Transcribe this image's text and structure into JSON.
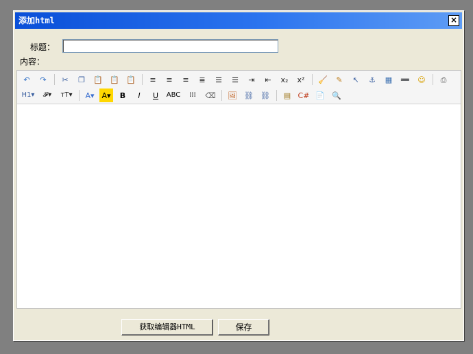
{
  "dialog": {
    "title": "添加html",
    "close_label": "×"
  },
  "form": {
    "title_label": "标题：",
    "content_label": "内容：",
    "title_value": ""
  },
  "toolbar": {
    "row1": [
      {
        "name": "undo-icon",
        "glyph": "↶",
        "color": "#2b6cc4"
      },
      {
        "name": "redo-icon",
        "glyph": "↷",
        "color": "#2b6cc4"
      },
      {
        "sep": true
      },
      {
        "name": "cut-icon",
        "glyph": "✂",
        "color": "#3a5fa0"
      },
      {
        "name": "copy-icon",
        "glyph": "❐",
        "color": "#3a5fa0"
      },
      {
        "name": "paste-icon",
        "glyph": "📋",
        "color": "#a07a20"
      },
      {
        "name": "paste-text-icon",
        "glyph": "📋",
        "color": "#a07a20"
      },
      {
        "name": "paste-word-icon",
        "glyph": "📋",
        "color": "#a07a20"
      },
      {
        "sep": true
      },
      {
        "name": "align-left-icon",
        "glyph": "≡",
        "color": "#222"
      },
      {
        "name": "align-center-icon",
        "glyph": "≡",
        "color": "#222"
      },
      {
        "name": "align-right-icon",
        "glyph": "≡",
        "color": "#222"
      },
      {
        "name": "align-justify-icon",
        "glyph": "≣",
        "color": "#222"
      },
      {
        "name": "ordered-list-icon",
        "glyph": "☰",
        "color": "#222"
      },
      {
        "name": "unordered-list-icon",
        "glyph": "☰",
        "color": "#222"
      },
      {
        "name": "indent-icon",
        "glyph": "⇥",
        "color": "#222"
      },
      {
        "name": "outdent-icon",
        "glyph": "⇤",
        "color": "#222"
      },
      {
        "name": "subscript-icon",
        "glyph": "x₂",
        "color": "#222"
      },
      {
        "name": "superscript-icon",
        "glyph": "x²",
        "color": "#222"
      },
      {
        "sep": true
      },
      {
        "name": "clear-format-icon",
        "glyph": "🧹",
        "color": "#c08020"
      },
      {
        "name": "select-all-icon",
        "glyph": "✎",
        "color": "#c08020"
      },
      {
        "name": "cursor-icon",
        "glyph": "↖",
        "color": "#3a5fa0"
      },
      {
        "name": "anchor-icon",
        "glyph": "⚓",
        "color": "#3a5fa0"
      },
      {
        "name": "table-icon",
        "glyph": "▦",
        "color": "#3a6fb0"
      },
      {
        "name": "horizontal-rule-icon",
        "glyph": "➖",
        "color": "#c04020"
      },
      {
        "name": "emoticon-icon",
        "glyph": "☺",
        "color": "#d8a000"
      },
      {
        "sep": true
      },
      {
        "name": "print-icon",
        "glyph": "⎙",
        "color": "#666"
      }
    ],
    "row2": [
      {
        "name": "heading-icon",
        "glyph": "H1▾",
        "color": "#3a5fa0"
      },
      {
        "name": "font-family-icon",
        "glyph": "𝓕▾",
        "color": "#222"
      },
      {
        "name": "font-size-icon",
        "glyph": "тT▾",
        "color": "#222"
      },
      {
        "sep": true
      },
      {
        "name": "font-color-icon",
        "glyph": "A▾",
        "color": "#3a6fd0"
      },
      {
        "name": "highlight-color-icon",
        "glyph": "A▾",
        "color": "#000"
      },
      {
        "name": "bold-icon",
        "glyph": "B",
        "color": "#000"
      },
      {
        "name": "italic-icon",
        "glyph": "I",
        "color": "#000"
      },
      {
        "name": "underline-icon",
        "glyph": "U",
        "color": "#000"
      },
      {
        "name": "strikethrough-icon",
        "glyph": "ABC",
        "color": "#000"
      },
      {
        "name": "line-height-icon",
        "glyph": "⁞⁞⁞",
        "color": "#000"
      },
      {
        "name": "eraser-icon",
        "glyph": "⌫",
        "color": "#555"
      },
      {
        "sep": true
      },
      {
        "name": "image-icon",
        "glyph": "🖼",
        "color": "#c06020"
      },
      {
        "name": "link-icon",
        "glyph": "⛓",
        "color": "#3a5fa0"
      },
      {
        "name": "unlink-icon",
        "glyph": "⛓",
        "color": "#3a5fa0"
      },
      {
        "sep": true
      },
      {
        "name": "source-html-icon",
        "glyph": "▤",
        "color": "#a07a20"
      },
      {
        "name": "code-icon",
        "glyph": "C#",
        "color": "#c04020"
      },
      {
        "name": "template-icon",
        "glyph": "📄",
        "color": "#333"
      },
      {
        "name": "preview-icon",
        "glyph": "🔍",
        "color": "#333"
      }
    ]
  },
  "buttons": {
    "get_html_label": "获取编辑器HTML",
    "save_label": "保存"
  },
  "colors": {
    "titlebar_start": "#0a4fd8",
    "titlebar_end": "#5e9cf5",
    "dialog_bg": "#ece9d8",
    "backdrop": "#808080",
    "highlight_bg": "#ffd700"
  }
}
